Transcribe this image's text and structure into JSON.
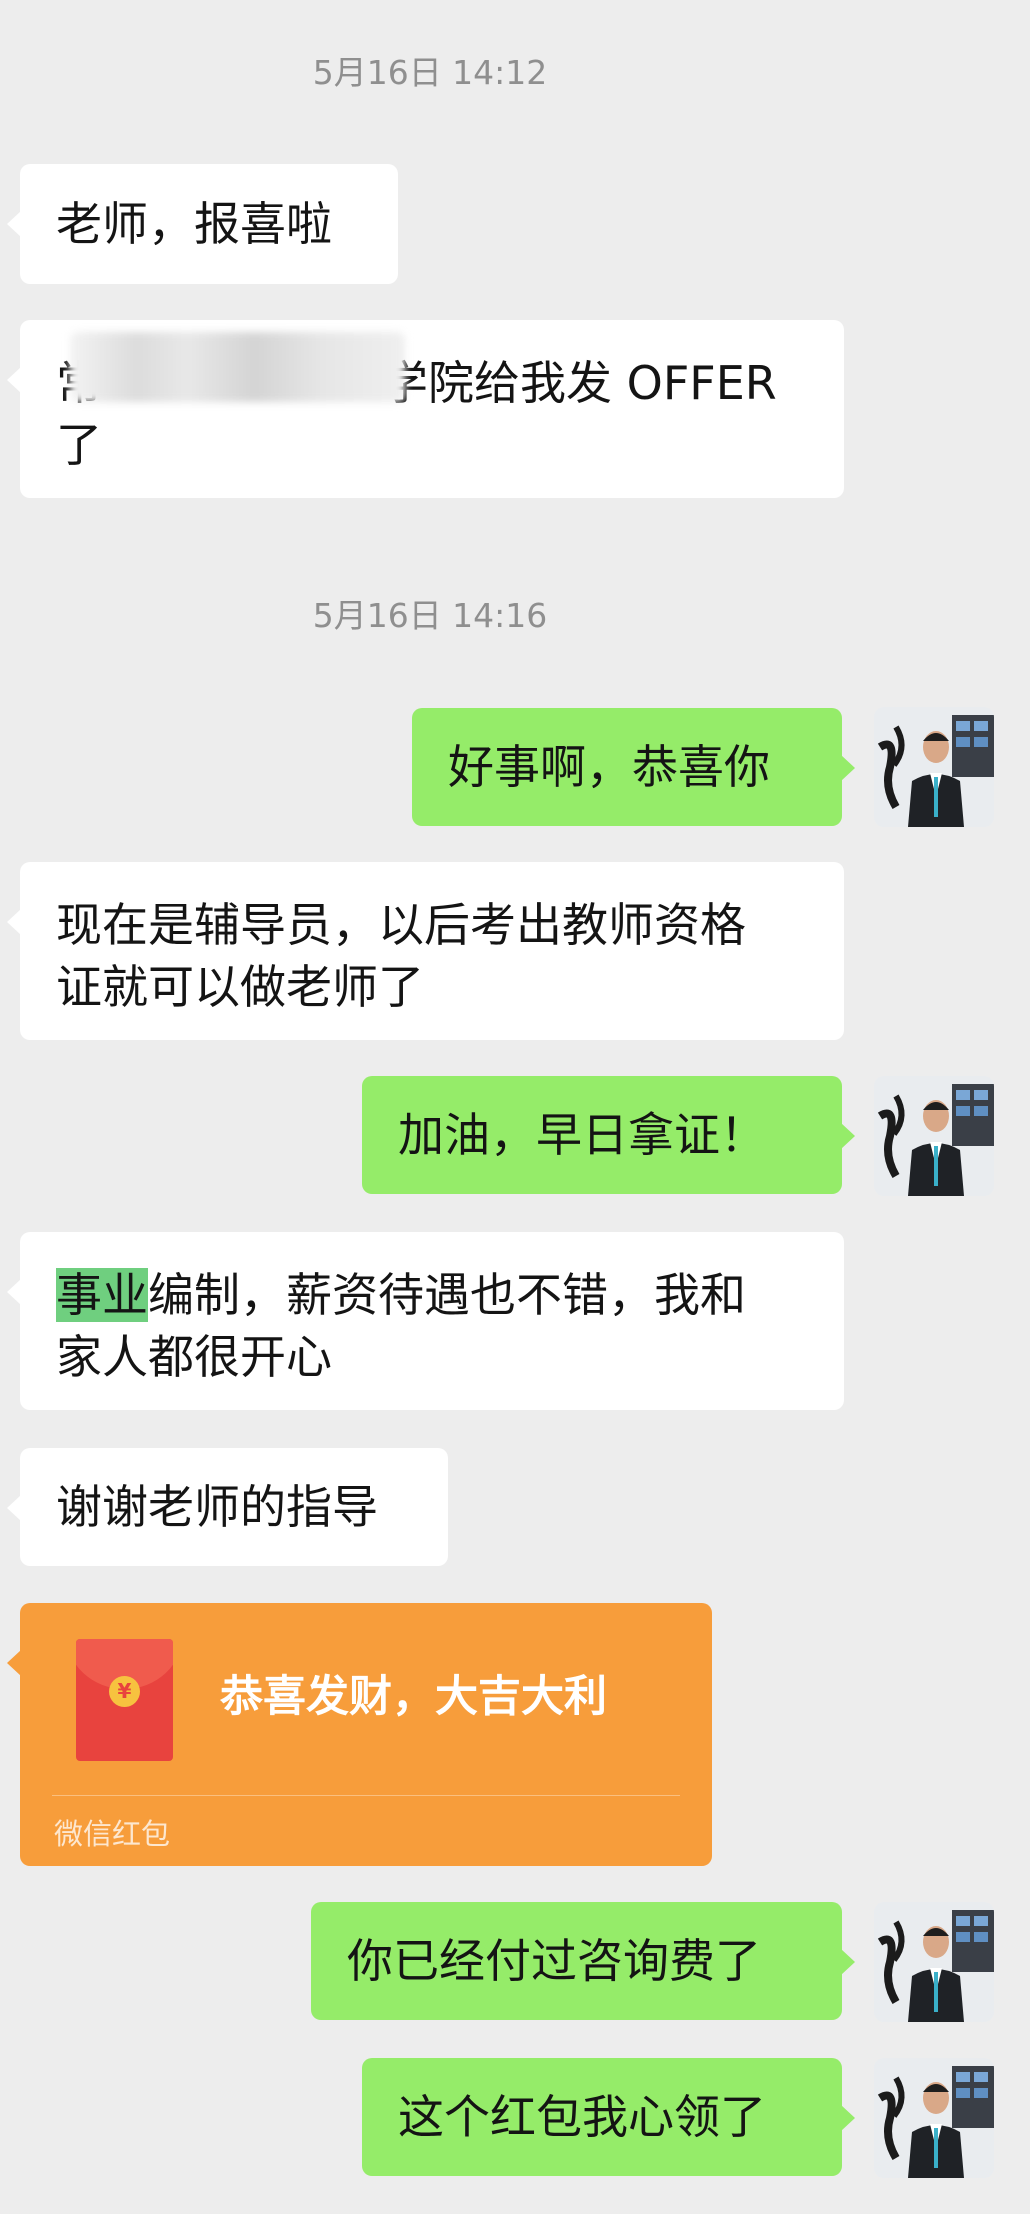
{
  "chat": {
    "timestamps": [
      "5月16日 14:12",
      "5月16日 14:16"
    ],
    "messages": {
      "m1": "老师，报喜啦",
      "m2_line1_start": "常",
      "m2_line1_end": "学院给我发 OFFER",
      "m2_line2": "了",
      "m3": "好事啊，恭喜你",
      "m4_line1": "现在是辅导员，以后考出教师资格",
      "m4_line2": "证就可以做老师了",
      "m5": "加油，早日拿证！",
      "m6_highlight": "事业",
      "m6_line1_rest": "编制，薪资待遇也不错，我和",
      "m6_line2": "家人都很开心",
      "m7": "谢谢老师的指导",
      "m8": "你已经付过咨询费了",
      "m9": "这个红包我心领了"
    },
    "red_packet": {
      "title": "恭喜发财，大吉大利",
      "footer": "微信红包",
      "coin_symbol": "¥",
      "icon": "red-envelope-icon"
    }
  },
  "colors": {
    "background": "#ededed",
    "incoming_bubble": "#ffffff",
    "outgoing_bubble": "#95ec69",
    "red_packet": "#f79d3b",
    "highlight": "#6fcf7f"
  }
}
